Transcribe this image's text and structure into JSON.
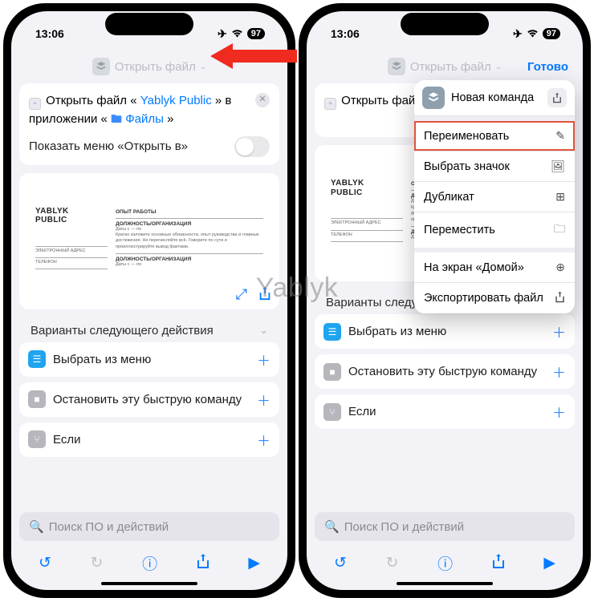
{
  "status": {
    "time": "13:06",
    "battery": "97"
  },
  "header": {
    "title": "Открыть файл",
    "done": "Готово"
  },
  "action_card": {
    "prefix": "Открыть файл",
    "angle_open": "«",
    "file1": "Yablyk",
    "file2": "Public",
    "angle_close": "»",
    "mid": "в приложении",
    "app": "Файлы",
    "toggle_label": "Показать меню «Открыть в»"
  },
  "doc": {
    "t1": "YABLYK",
    "t2": "PUBLIC",
    "sec1": "ОПЫТ РАБОТЫ",
    "sec2": "ДОЛЖНОСТЬ/ОРГАНИЗАЦИЯ",
    "dates": "Даты с — по",
    "desc": "Кратко изложите основные обязанности, опыт руководства и главные достижения. Не перечисляйте всё. Говорите по сути и проиллюстрируйте вывод фактами.",
    "left1": "ЭЛЕКТРОННЫЙ АДРЕС",
    "left2": "ТЕЛЕФОН"
  },
  "next": {
    "h": "Варианты следующего действия",
    "i1": "Выбрать из меню",
    "i2": "Остановить эту быструю команду",
    "i3": "Если"
  },
  "search": {
    "placeholder": "Поиск ПО и действий"
  },
  "popover": {
    "title": "Новая команда",
    "rename": "Переименовать",
    "choose_icon": "Выбрать значок",
    "duplicate": "Дубликат",
    "move": "Переместить",
    "home": "На экран «Домой»",
    "export": "Экспортировать файл"
  },
  "right_card_mid": "в прил",
  "watermark": "Yablyk"
}
